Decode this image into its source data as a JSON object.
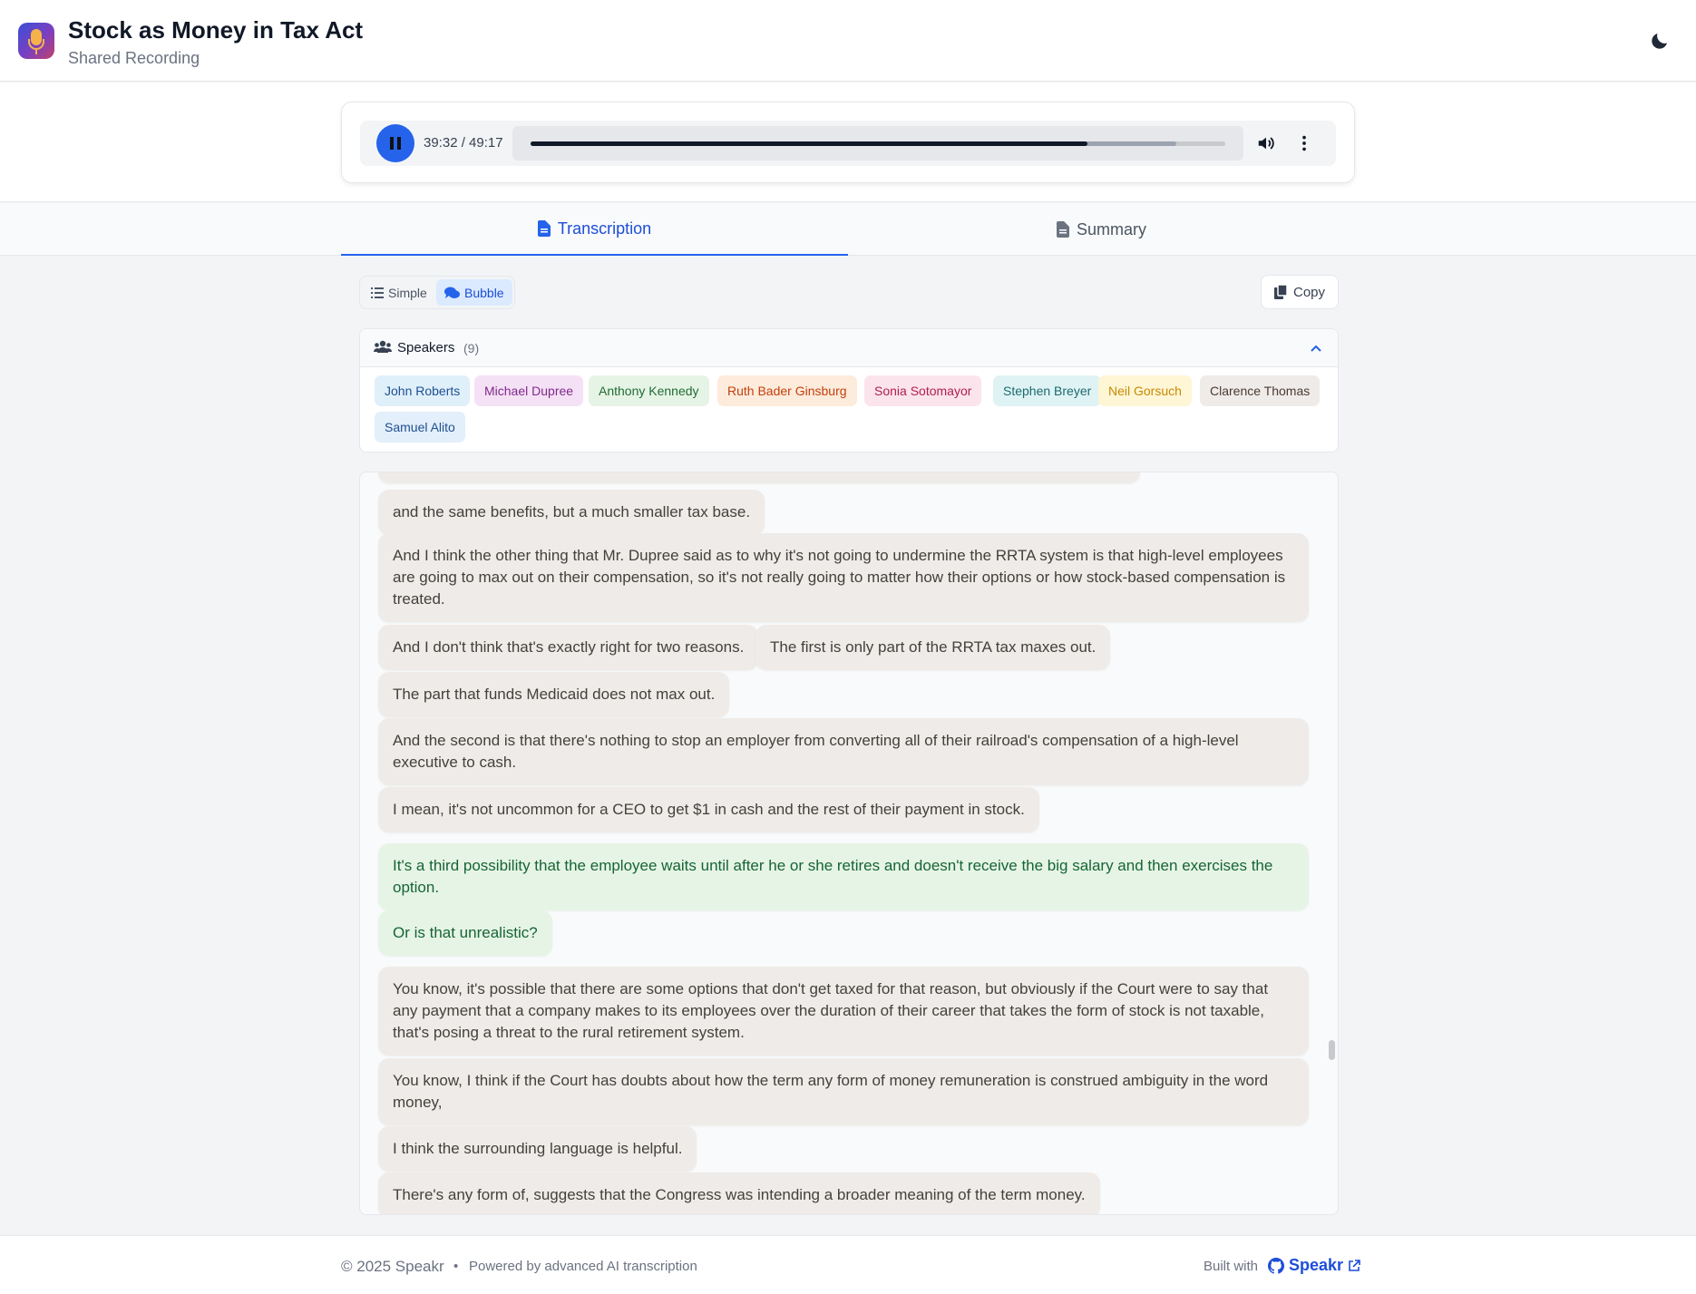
{
  "header": {
    "title": "Stock as Money in Tax Act",
    "subtitle": "Shared Recording"
  },
  "player": {
    "time": "39:32 / 49:17",
    "progress_fraction": 0.802,
    "buffered_fraction": 0.93
  },
  "tabs": [
    {
      "label": "Transcription",
      "active": true
    },
    {
      "label": "Summary",
      "active": false
    }
  ],
  "view_modes": {
    "simple": "Simple",
    "bubble": "Bubble",
    "active": "Bubble"
  },
  "copy_label": "Copy",
  "speakers": {
    "label": "Speakers",
    "count": "(9)",
    "list": [
      {
        "name": "John Roberts",
        "bg": "#e0f0fb",
        "fg": "#1e4f91"
      },
      {
        "name": "Michael Dupree",
        "bg": "#f5e1f5",
        "fg": "#7e2a8c"
      },
      {
        "name": "Anthony Kennedy",
        "bg": "#e6f4e6",
        "fg": "#226b34"
      },
      {
        "name": "Ruth Bader Ginsburg",
        "bg": "#fdebdc",
        "fg": "#c2410c"
      },
      {
        "name": "Sonia Sotomayor",
        "bg": "#fce4ec",
        "fg": "#b0204f"
      },
      {
        "name": "Stephen Breyer",
        "bg": "#e0f3f4",
        "fg": "#1b6a70"
      },
      {
        "name": "Neil Gorsuch",
        "bg": "#fef6d4",
        "fg": "#c78a07"
      },
      {
        "name": "Clarence Thomas",
        "bg": "#efebe8",
        "fg": "#4b3a33"
      },
      {
        "name": "Samuel Alito",
        "bg": "#e3effa",
        "fg": "#1e4f91"
      }
    ]
  },
  "transcript": [
    {
      "text": "and the same benefits, but a much smaller tax base.",
      "tone": "brown"
    },
    {
      "text": "And I think the other thing that Mr. Dupree said as to why it's not going to undermine the RRTA system is that high-level employees are going to max out on their compensation, so it's not really going to matter how their options or how stock-based compensation is treated.",
      "tone": "brown"
    },
    {
      "text": "And I don't think that's exactly right for two reasons.",
      "tone": "brown"
    },
    {
      "text": "The first is only part of the RRTA tax maxes out.",
      "tone": "brown"
    },
    {
      "text": "The part that funds Medicaid does not max out.",
      "tone": "brown"
    },
    {
      "text": "And the second is that there's nothing to stop an employer from converting all of their railroad's compensation of a high-level executive to cash.",
      "tone": "brown"
    },
    {
      "text": "I mean, it's not uncommon for a CEO to get $1 in cash and the rest of their payment in stock.",
      "tone": "brown"
    },
    {
      "text": "It's a third possibility that the employee waits until after he or she retires and doesn't receive the big salary and then exercises the option.",
      "tone": "green"
    },
    {
      "text": "Or is that unrealistic?",
      "tone": "green"
    },
    {
      "text": "You know, it's possible that there are some options that don't get taxed for that reason, but obviously if the Court were to say that any payment that a company makes to its employees over the duration of their career that takes the form of stock is not taxable, that's posing a threat to the rural retirement system.",
      "tone": "brown"
    },
    {
      "text": "You know, I think if the Court has doubts about how the term any form of money remuneration is construed ambiguity in the word money,",
      "tone": "brown"
    },
    {
      "text": "I think the surrounding language is helpful.",
      "tone": "brown"
    },
    {
      "text": "There's any form of, suggests that the Congress was intending a broader meaning of the term money.",
      "tone": "brown"
    }
  ],
  "footer": {
    "copyright": "© 2025 Speakr",
    "separator": "•",
    "powered": "Powered by advanced AI transcription",
    "built_with": "Built with",
    "brand": "Speakr"
  }
}
